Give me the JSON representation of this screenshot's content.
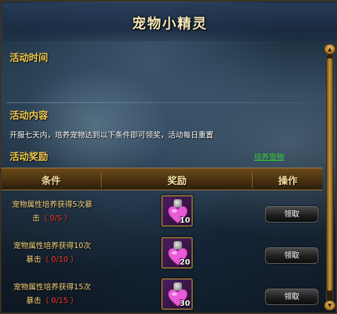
{
  "window": {
    "title": "宠物小精灵"
  },
  "sections": {
    "time_label": "活动时间",
    "content_label": "活动内容",
    "content_text": "开服七天内，培养宠物达到以下条件即可领奖，活动每日重置",
    "reward_label": "活动奖励",
    "link_label": "培养宠物"
  },
  "table": {
    "headers": [
      "条件",
      "奖励",
      "操作"
    ],
    "rows": [
      {
        "cond_line1": "宠物属性培养获得5次暴",
        "cond_line2": "击",
        "progress": "（ 0/5 ）",
        "qty": "10",
        "button": "领取"
      },
      {
        "cond_line1": "宠物属性培养获得10次",
        "cond_line2": "暴击",
        "progress": "（ 0/10 ）",
        "qty": "20",
        "button": "领取"
      },
      {
        "cond_line1": "宠物属性培养获得15次",
        "cond_line2": "暴击",
        "progress": "（ 0/15 ）",
        "qty": "30",
        "button": "领取"
      }
    ]
  },
  "icons": {
    "reward": "pink-heart-potion-icon",
    "scroll_up": "arrow-up-icon",
    "scroll_down": "arrow-down-icon"
  },
  "colors": {
    "section_label": "#f2c94c",
    "link": "#33cc33",
    "progress": "#ff3b2b",
    "condition": "#f5d57a"
  }
}
